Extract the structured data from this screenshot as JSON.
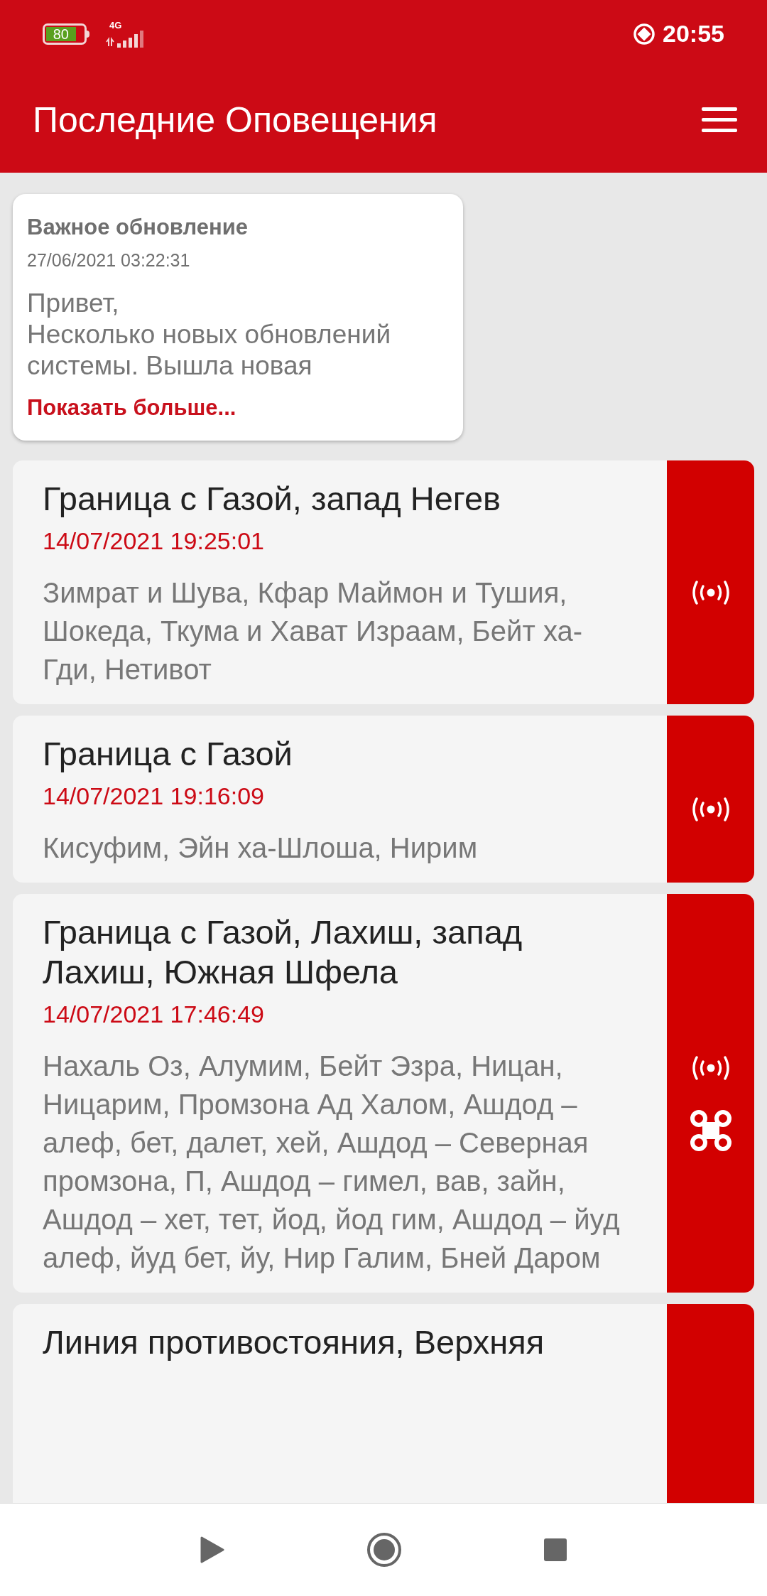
{
  "status_bar": {
    "battery": "80",
    "network": "4G",
    "time": "20:55"
  },
  "app_bar": {
    "title": "Последние Оповещения"
  },
  "notice": {
    "title": "Важное обновление",
    "date": "27/06/2021 03:22:31",
    "body_lines": [
      "Привет,",
      "Несколько новых обновлений",
      "системы. Вышла новая"
    ],
    "link": "Показать больше..."
  },
  "alerts": [
    {
      "title": "Граница с Газой, запад Негев",
      "time": "14/07/2021 19:25:01",
      "places": "Зимрат и Шува, Кфар Маймон и Тушия, Шокеда, Ткума и Хават Израам, Бейт ха-Гди, Нетивот",
      "icons": [
        {
          "kind": "broadcast"
        }
      ]
    },
    {
      "title": "Граница с Газой",
      "time": "14/07/2021 19:16:09",
      "places": "Кисуфим, Эйн ха-Шлоша, Нирим",
      "icons": [
        {
          "kind": "broadcast"
        }
      ]
    },
    {
      "title": "Граница с Газой, Лахиш, запад Лахиш, Южная Шфела",
      "time": "14/07/2021 17:46:49",
      "places": "Нахаль Оз, Алумим, Бейт Эзра, Ницан, Ницарим, Промзона Ад Халом, Ашдод – алеф, бет, далет, хей, Ашдод – Северная промзона, П, Ашдод – гимел, вав, зайн, Ашдод – хет, тет, йод, йод гим, Ашдод – йуд алеф, йуд бет, йу, Нир Галим, Бней Даром",
      "icons": [
        {
          "kind": "broadcast"
        },
        {
          "kind": "drone"
        }
      ]
    },
    {
      "title": "Линия противостояния, Верхняя"
    }
  ]
}
